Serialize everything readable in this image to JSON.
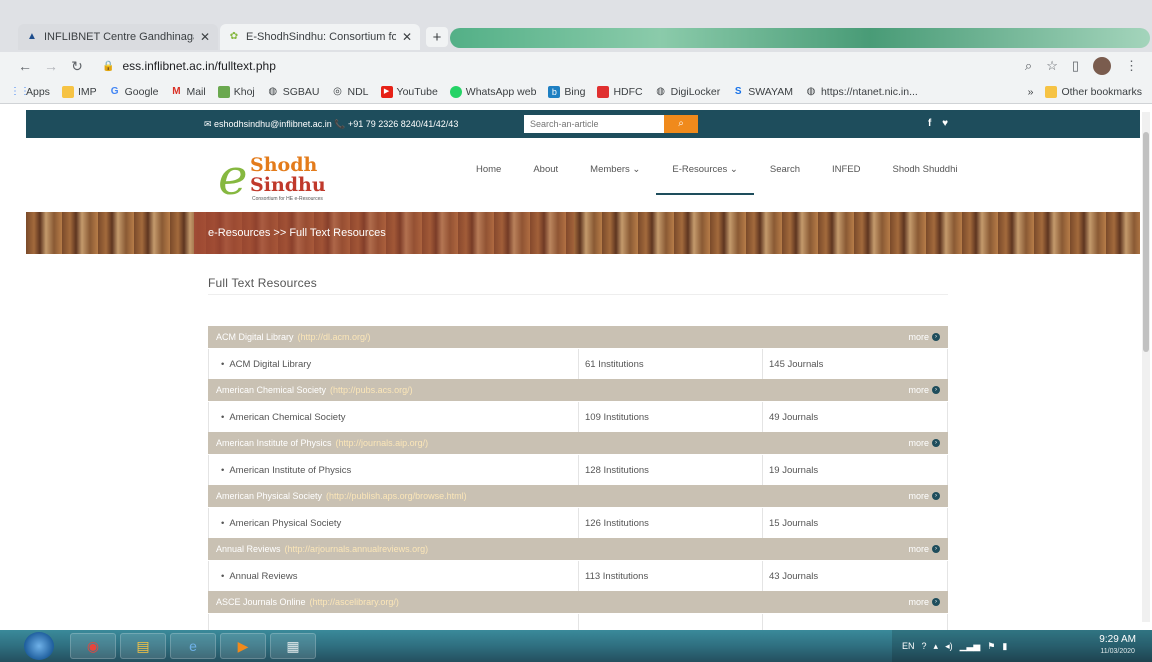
{
  "browser": {
    "tabs": [
      {
        "title": "INFLIBNET Centre Gandhinagar",
        "active": false
      },
      {
        "title": "E-ShodhSindhu: Consortium for",
        "active": true
      }
    ],
    "new_tab_glyph": "+",
    "close_glyph": "✕",
    "url": "ess.inflibnet.ac.in/fulltext.php",
    "bookmarks": [
      {
        "label": "Apps",
        "icon": "apps-grid-icon"
      },
      {
        "label": "IMP",
        "icon": "folder-icon"
      },
      {
        "label": "Google",
        "icon": "google-icon"
      },
      {
        "label": "Mail",
        "icon": "gmail-icon"
      },
      {
        "label": "Khoj",
        "icon": "khoj-icon"
      },
      {
        "label": "SGBAU",
        "icon": "globe-icon"
      },
      {
        "label": "NDL",
        "icon": "ndl-icon"
      },
      {
        "label": "YouTube",
        "icon": "youtube-icon"
      },
      {
        "label": "WhatsApp web",
        "icon": "whatsapp-icon"
      },
      {
        "label": "Bing",
        "icon": "bing-icon"
      },
      {
        "label": "HDFC",
        "icon": "hdfc-icon"
      },
      {
        "label": "DigiLocker",
        "icon": "globe-icon"
      },
      {
        "label": "SWAYAM",
        "icon": "swayam-icon"
      },
      {
        "label": "https://ntanet.nic.in...",
        "icon": "globe-icon"
      }
    ],
    "bookmarks_overflow": "»",
    "other_bookmarks": "Other bookmarks"
  },
  "site": {
    "contact": "✉ eshodhsindhu@inflibnet.ac.in  📞 +91 79 2326 8240/41/42/43",
    "search_placeholder": "Search-an-article",
    "social": "f ♥",
    "logo": {
      "e": "e",
      "shodh": "Shodh",
      "sindhu": "Sindhu",
      "tagline": "Consortium for HE e-Resources"
    },
    "nav": [
      {
        "label": "Home",
        "active": false
      },
      {
        "label": "About",
        "active": false
      },
      {
        "label": "Members ⌄",
        "active": false
      },
      {
        "label": "E-Resources ⌄",
        "active": true
      },
      {
        "label": "Search",
        "active": false
      },
      {
        "label": "INFED",
        "active": false
      },
      {
        "label": "Shodh Shuddhi",
        "active": false
      }
    ],
    "breadcrumb": "e-Resources >> Full Text Resources",
    "section_title": "Full Text Resources",
    "more_label": "more",
    "resources": [
      {
        "name": "ACM Digital Library",
        "url": "(http://dl.acm.org/)",
        "item": "ACM Digital Library",
        "institutions": "61 Institutions",
        "journals": "145 Journals"
      },
      {
        "name": "American Chemical Society",
        "url": "(http://pubs.acs.org/)",
        "item": "American Chemical Society",
        "institutions": "109 Institutions",
        "journals": "49 Journals"
      },
      {
        "name": "American Institute of Physics",
        "url": "(http://journals.aip.org/)",
        "item": "American Institute of Physics",
        "institutions": "128 Institutions",
        "journals": "19 Journals"
      },
      {
        "name": "American Physical Society",
        "url": "(http://publish.aps.org/browse.html)",
        "item": "American Physical Society",
        "institutions": "126 Institutions",
        "journals": "15 Journals"
      },
      {
        "name": "Annual Reviews",
        "url": "(http://arjournals.annualreviews.org)",
        "item": "Annual Reviews",
        "institutions": "113 Institutions",
        "journals": "43 Journals"
      },
      {
        "name": "ASCE Journals Online",
        "url": "(http://ascelibrary.org/)",
        "item": "",
        "institutions": "",
        "journals": ""
      }
    ]
  },
  "taskbar": {
    "lang": "EN",
    "time": "9:29 AM",
    "date": "11/03/2020"
  },
  "colors": {
    "top_strip": "#1e4d5c",
    "search_button": "#f08a1c",
    "group_row": "#c9c1b3"
  }
}
